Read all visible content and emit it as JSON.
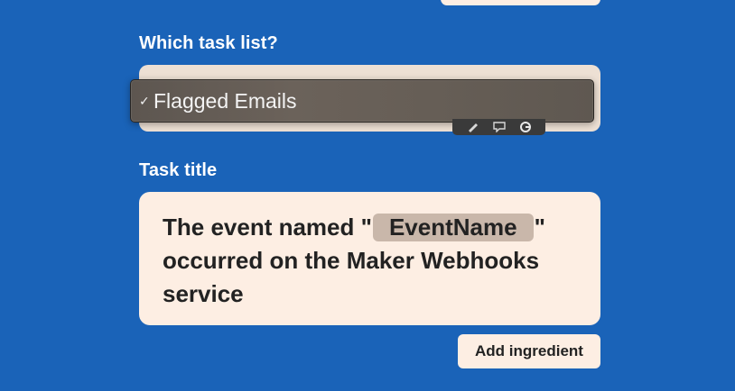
{
  "task_list": {
    "label": "Which task list?",
    "selected_option": "Flagged Emails",
    "check_mark": "✓"
  },
  "task_title": {
    "label": "Task title",
    "text_before": "The event named \"",
    "ingredient": "EventName",
    "text_after": "\" occurred on the Maker Webhooks service"
  },
  "add_ingredient_label": "Add ingredient",
  "colors": {
    "background": "#1a63b8",
    "field_bg": "#fdeee3",
    "pill_bg": "#c9b7aa",
    "popup_bg": "#665e56"
  },
  "toolbar_icons": [
    "pencil-icon",
    "speech-bubble-icon",
    "grammarly-icon"
  ]
}
